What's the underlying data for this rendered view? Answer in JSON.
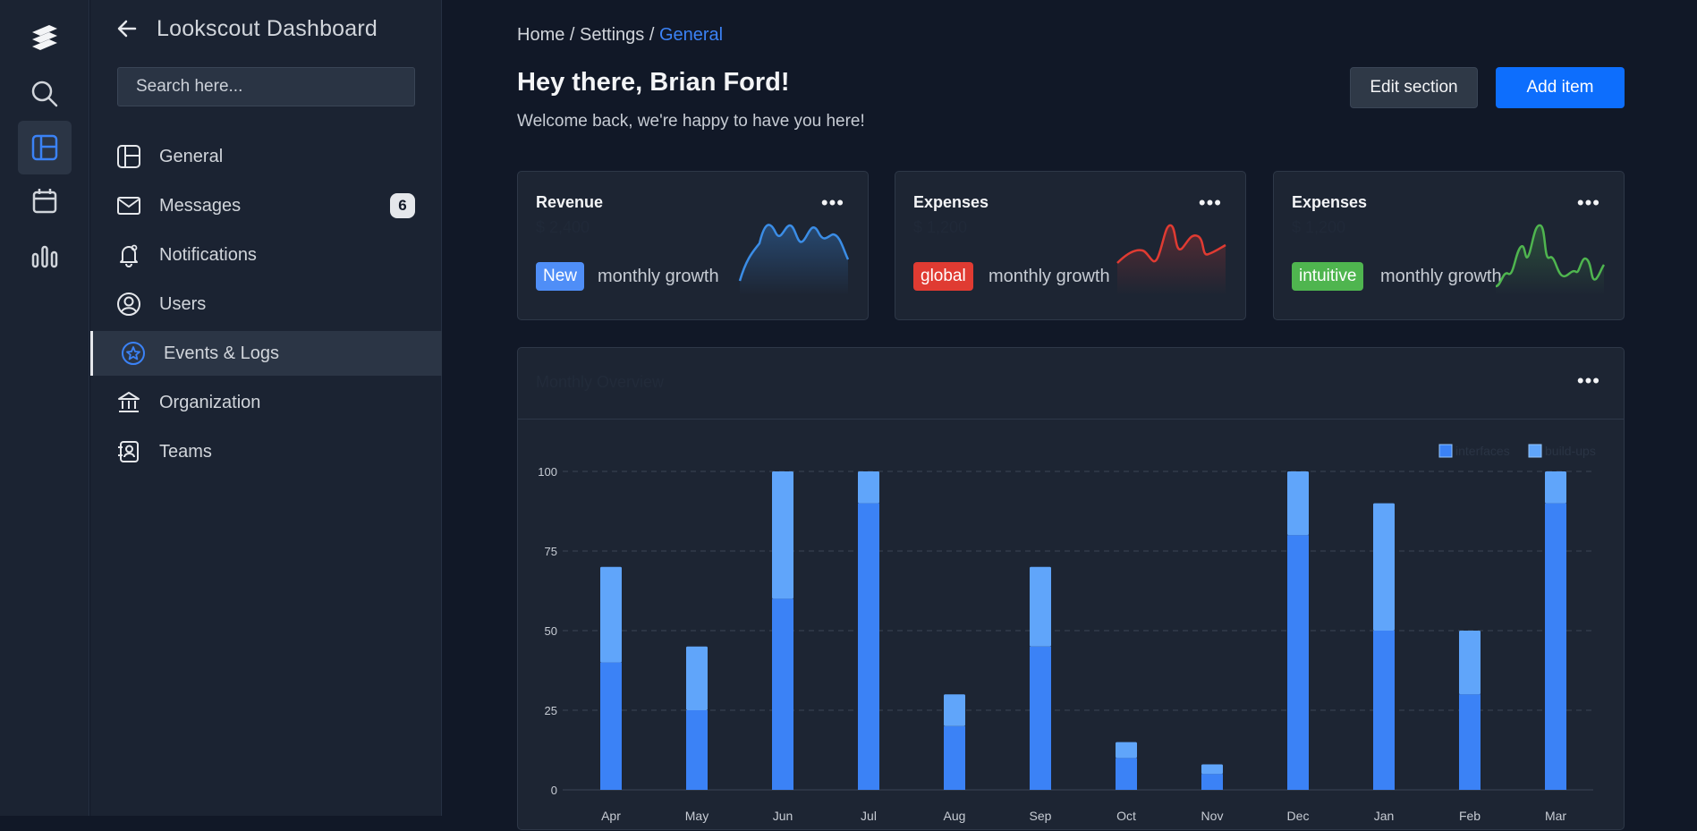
{
  "app": {
    "title": "Lookscout Dashboard"
  },
  "search": {
    "placeholder": "Search here..."
  },
  "rail": {
    "items": [
      "logo-icon",
      "search-icon",
      "layout-icon",
      "calendar-icon",
      "bar-chart-icon"
    ]
  },
  "sidebar": {
    "items": [
      {
        "label": "General",
        "icon": "layout-icon"
      },
      {
        "label": "Messages",
        "icon": "mail-icon",
        "badge": "6"
      },
      {
        "label": "Notifications",
        "icon": "bell-icon"
      },
      {
        "label": "Users",
        "icon": "user-circle-icon"
      },
      {
        "label": "Events & Logs",
        "icon": "star-circle-icon",
        "active": true
      },
      {
        "label": "Organization",
        "icon": "bank-icon"
      },
      {
        "label": "Teams",
        "icon": "contact-book-icon"
      }
    ]
  },
  "breadcrumb": {
    "home": "Home",
    "sep": " / ",
    "settings": "Settings",
    "current": "General"
  },
  "header": {
    "greeting": "Hey there, Brian Ford!",
    "welcome": "Welcome back, we're happy to have you here!",
    "edit_label": "Edit section",
    "add_label": "Add item"
  },
  "colors": {
    "accent": "#0d6efd",
    "blue_tag": "#3b82f6",
    "red_tag": "#e03b32",
    "green_tag": "#4fb54f",
    "bar_primary": "#3b82f6",
    "bar_secondary": "#60a5fa"
  },
  "cards": [
    {
      "title": "Revenue",
      "value": "$ 2,400",
      "tag": "New",
      "tag_color": "#4f8ef7",
      "growth": "monthly growth",
      "line_color": "#3b8de6"
    },
    {
      "title": "Expenses",
      "value": "$ 1,200",
      "tag": "global",
      "tag_color": "#e03b32",
      "growth": "monthly growth",
      "line_color": "#e03b32"
    },
    {
      "title": "Expenses",
      "value": "$ 1,200",
      "tag": "intuitive",
      "tag_color": "#4fb54f",
      "growth": "monthly growth",
      "line_color": "#4fb54f"
    }
  ],
  "chart_section": {
    "title": "Monthly Overview",
    "more": "•••"
  },
  "chart_data": {
    "type": "bar",
    "stacked": true,
    "categories": [
      "Apr",
      "May",
      "Jun",
      "Jul",
      "Aug",
      "Sep",
      "Oct",
      "Nov",
      "Dec",
      "Jan",
      "Feb",
      "Mar"
    ],
    "series": [
      {
        "name": "interfaces",
        "color": "#3b82f6",
        "values": [
          40,
          25,
          60,
          90,
          20,
          45,
          10,
          5,
          80,
          50,
          30,
          90
        ]
      },
      {
        "name": "build-ups",
        "color": "#60a5fa",
        "values": [
          30,
          20,
          40,
          10,
          10,
          25,
          5,
          3,
          20,
          40,
          20,
          10
        ]
      }
    ],
    "yticks": [
      0,
      25,
      50,
      75,
      100
    ],
    "ylim": [
      0,
      100
    ],
    "grid": true,
    "legend": "top-right"
  }
}
